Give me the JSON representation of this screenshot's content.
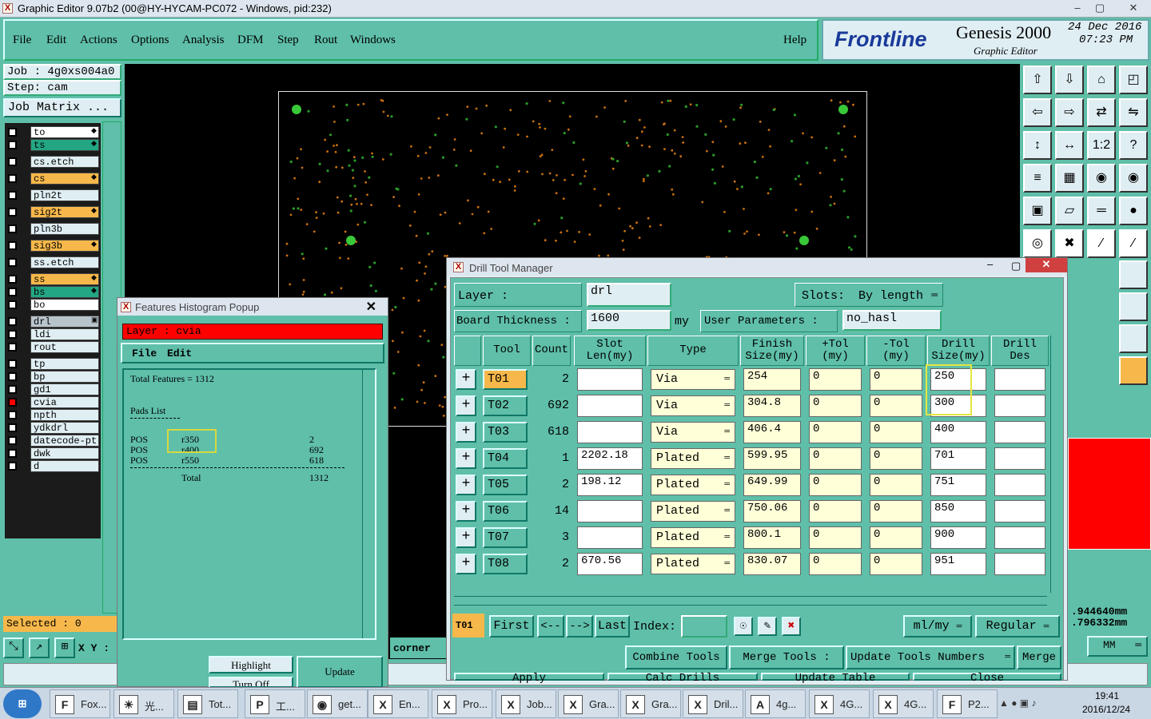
{
  "window": {
    "title": "Graphic Editor 9.07b2 (00@HY-HYCAM-PC072 - Windows, pid:232)"
  },
  "menu": [
    "File",
    "Edit",
    "Actions",
    "Options",
    "Analysis",
    "DFM",
    "Step",
    "Rout",
    "Windows"
  ],
  "help": "Help",
  "logo": {
    "brand": "Frontline",
    "product": "Genesis 2000",
    "subtitle": "Graphic Editor",
    "date": "24 Dec 2016",
    "time": "07:23 PM"
  },
  "job": {
    "job_label": "Job : 4g0xs004a0",
    "step_label": "Step: cam",
    "matrix_button": "Job Matrix ..."
  },
  "layers_group1": [
    {
      "name": "to",
      "color": "#ffffff",
      "flag": "◆"
    },
    {
      "name": "ts",
      "color": "#22a683",
      "flag": "◆"
    },
    {
      "name": "cs.etch",
      "color": "#dfeef3",
      "flag": ""
    },
    {
      "name": "cs",
      "color": "#f6b84a",
      "flag": "◆"
    },
    {
      "name": "pln2t",
      "color": "#dfeef3",
      "flag": ""
    },
    {
      "name": "sig2t",
      "color": "#f6b84a",
      "flag": "◆"
    },
    {
      "name": "pln3b",
      "color": "#dfeef3",
      "flag": ""
    },
    {
      "name": "sig3b",
      "color": "#f6b84a",
      "flag": "◆"
    },
    {
      "name": "ss.etch",
      "color": "#dfeef3",
      "flag": ""
    },
    {
      "name": "ss",
      "color": "#f6b84a",
      "flag": "◆"
    },
    {
      "name": "bs",
      "color": "#22a683",
      "flag": "◆"
    },
    {
      "name": "bo",
      "color": "#ffffff",
      "flag": ""
    }
  ],
  "layers_group2": [
    {
      "name": "drl",
      "color": "#b8c4cc",
      "flag": "▣"
    },
    {
      "name": "ldi",
      "color": "#dfeef3",
      "flag": ""
    },
    {
      "name": "rout",
      "color": "#dfeef3",
      "flag": ""
    }
  ],
  "layers_group3": [
    {
      "name": "tp",
      "color": "#dfeef3"
    },
    {
      "name": "bp",
      "color": "#dfeef3"
    },
    {
      "name": "gd1",
      "color": "#dfeef3"
    },
    {
      "name": "cvia",
      "color": "#dfeef3"
    },
    {
      "name": "npth",
      "color": "#dfeef3"
    },
    {
      "name": "ydkdrl",
      "color": "#dfeef3"
    },
    {
      "name": "datecode-pt",
      "color": "#dfeef3"
    },
    {
      "name": "dwk",
      "color": "#dfeef3"
    },
    {
      "name": "d",
      "color": "#dfeef3"
    }
  ],
  "selected": "Selected : 0",
  "xy_label": "X Y :",
  "corner_label": "corner",
  "coords": {
    "x": ".944640mm",
    "y": ".796332mm"
  },
  "units_btn": "MM",
  "histogram": {
    "title": "Features Histogram Popup",
    "layer": "Layer :  cvia",
    "menu": [
      "File",
      "Edit"
    ],
    "total": "Total Features = 1312",
    "pads_title": "Pads List",
    "rows": [
      {
        "type": "POS",
        "sym": "r350",
        "count": "2"
      },
      {
        "type": "POS",
        "sym": "r400",
        "count": "692"
      },
      {
        "type": "POS",
        "sym": "r550",
        "count": "618"
      }
    ],
    "total_label": "Total",
    "total_count": "1312",
    "highlight": "Highlight",
    "turnoff": "Turn Off",
    "update": "Update"
  },
  "dtm": {
    "title": "Drill Tool Manager",
    "layer_label": "Layer          :",
    "layer_value": "drl",
    "slots_label": "Slots:",
    "slots_value": "By length",
    "thickness_label": "Board Thickness :",
    "thickness_value": "1600",
    "thickness_unit": "my",
    "user_params_label": "User Parameters :",
    "user_params_value": "no_hasl",
    "headers": [
      "Tool",
      "Count",
      "Slot Len(my)",
      "Type",
      "Finish Size(my)",
      "+Tol (my)",
      "-Tol (my)",
      "Drill Size(my)",
      "Drill Des"
    ],
    "rows": [
      {
        "tool": "T01",
        "count": "2",
        "slot": "",
        "type": "Via",
        "finish": "254",
        "ptol": "0",
        "mtol": "0",
        "drill": "250"
      },
      {
        "tool": "T02",
        "count": "692",
        "slot": "",
        "type": "Via",
        "finish": "304.8",
        "ptol": "0",
        "mtol": "0",
        "drill": "300"
      },
      {
        "tool": "T03",
        "count": "618",
        "slot": "",
        "type": "Via",
        "finish": "406.4",
        "ptol": "0",
        "mtol": "0",
        "drill": "400"
      },
      {
        "tool": "T04",
        "count": "1",
        "slot": "2202.18",
        "type": "Plated",
        "finish": "599.95",
        "ptol": "0",
        "mtol": "0",
        "drill": "701"
      },
      {
        "tool": "T05",
        "count": "2",
        "slot": "198.12",
        "type": "Plated",
        "finish": "649.99",
        "ptol": "0",
        "mtol": "0",
        "drill": "751"
      },
      {
        "tool": "T06",
        "count": "14",
        "slot": "",
        "type": "Plated",
        "finish": "750.06",
        "ptol": "0",
        "mtol": "0",
        "drill": "850"
      },
      {
        "tool": "T07",
        "count": "3",
        "slot": "",
        "type": "Plated",
        "finish": "800.1",
        "ptol": "0",
        "mtol": "0",
        "drill": "900"
      },
      {
        "tool": "T08",
        "count": "2",
        "slot": "670.56",
        "type": "Plated",
        "finish": "830.07",
        "ptol": "0",
        "mtol": "0",
        "drill": "951"
      }
    ],
    "current_tool": "T01",
    "nav": {
      "first": "First",
      "prev": "<--",
      "next": "-->",
      "last": "Last",
      "index": "Index:"
    },
    "units": "ml/my",
    "mode": "Regular",
    "buttons1": [
      "Combine Tools",
      "Merge Tools :",
      "Update Tools Numbers",
      "Merge"
    ],
    "buttons2": [
      "Apply",
      "Calc Drills",
      "Update Table",
      "Close"
    ]
  },
  "taskbar": {
    "items": [
      "Fox...",
      "光...",
      "Tot...",
      "工...",
      "get...",
      "En...",
      "Pro...",
      "Job...",
      "Gra...",
      "Gra...",
      "Dril...",
      "4g...",
      "4G...",
      "4G...",
      "P2..."
    ],
    "time": "19:41",
    "date": "2016/12/24"
  }
}
